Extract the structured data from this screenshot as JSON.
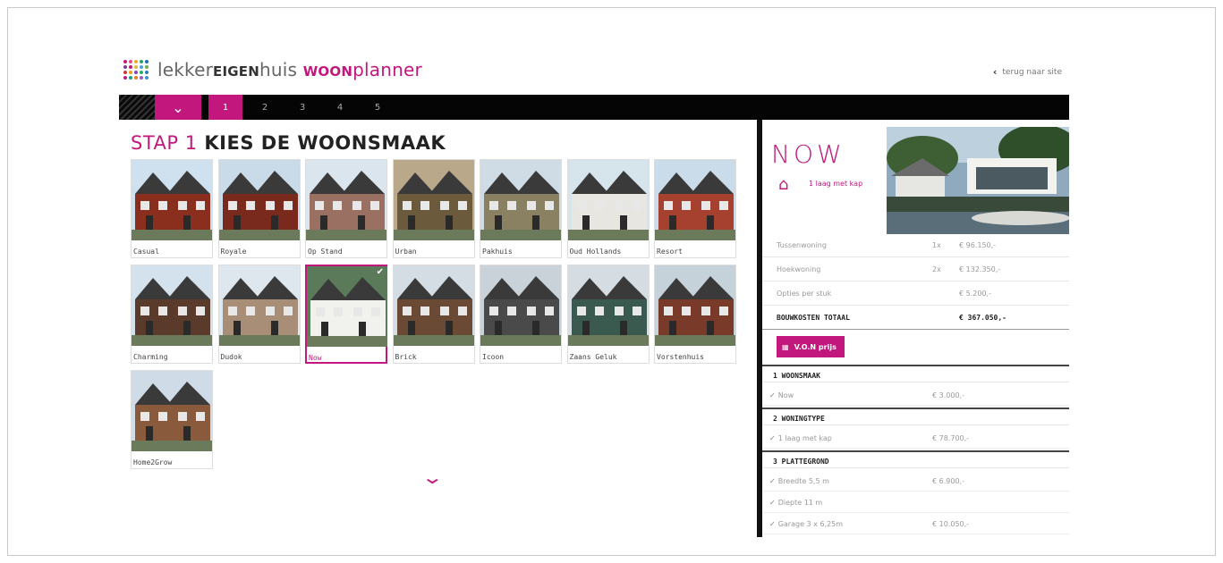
{
  "header": {
    "logo_part1": "lekker",
    "logo_part2": "EIGEN",
    "logo_part3": "huis ",
    "logo_part4": "WOON",
    "logo_part5": "planner",
    "back_link": "terug naar site"
  },
  "nav": {
    "steps": [
      "1",
      "2",
      "3",
      "4",
      "5"
    ],
    "active_step": "1"
  },
  "page": {
    "title_pink": "STAP 1",
    "title_rest": " KIES DE WOONSMAAK"
  },
  "tiles": [
    {
      "label": "Casual",
      "sky": "#cfe0ee",
      "house": "#8a2e1e"
    },
    {
      "label": "Royale",
      "sky": "#c9dbe8",
      "house": "#7a2a1c"
    },
    {
      "label": "Op Stand",
      "sky": "#dbe5ee",
      "house": "#9a7062"
    },
    {
      "label": "Urban",
      "sky": "#b9a88a",
      "house": "#6b5a3c"
    },
    {
      "label": "Pakhuis",
      "sky": "#cfdce6",
      "house": "#8a8062"
    },
    {
      "label": "Oud Hollands",
      "sky": "#d6e4ec",
      "house": "#e8e6e0"
    },
    {
      "label": "Resort",
      "sky": "#cadcea",
      "house": "#a5412e"
    },
    {
      "label": "Charming",
      "sky": "#d3e2ed",
      "house": "#5a3a2a"
    },
    {
      "label": "Dudok",
      "sky": "#dfe7ee",
      "house": "#a88e76"
    },
    {
      "label": "Now",
      "sky": "#5a7a5a",
      "house": "#f1f1ee",
      "selected": true
    },
    {
      "label": "Brick",
      "sky": "#d4dde4",
      "house": "#6a4a34"
    },
    {
      "label": "Icoon",
      "sky": "#c8d2d8",
      "house": "#4a4a4a"
    },
    {
      "label": "Zaans Geluk",
      "sky": "#d5dde3",
      "house": "#3a5a50"
    },
    {
      "label": "Vorstenhuis",
      "sky": "#c6d2da",
      "house": "#7a3a2a"
    },
    {
      "label": "Home2Grow",
      "sky": "#cfdbe6",
      "house": "#8a5a3c"
    }
  ],
  "panel": {
    "style_name": "NOW",
    "house_label": "1 laag met kap",
    "rows": [
      {
        "label": "Tussenwoning",
        "qty": "1x",
        "price": "€ 96.150,-"
      },
      {
        "label": "Hoekwoning",
        "qty": "2x",
        "price": "€ 132.350,-"
      },
      {
        "label": "Opties per stuk",
        "qty": "",
        "price": "€ 5.200,-"
      }
    ],
    "total_label": "BOUWKOSTEN TOTAAL",
    "total_value": "€ 367.050,-",
    "von_label": "V.O.N prijs",
    "sections": [
      {
        "title": "1 WOONSMAAK",
        "items": [
          {
            "label": "Now",
            "price": "€ 3.000,-"
          }
        ]
      },
      {
        "title": "2 WONINGTYPE",
        "items": [
          {
            "label": "1 laag met kap",
            "price": "€ 78.700,-"
          }
        ]
      },
      {
        "title": "3 PLATTEGROND",
        "items": [
          {
            "label": "Breedte 5,5 m",
            "price": "€ 6.900,-"
          },
          {
            "label": "Diepte 11 m",
            "price": ""
          },
          {
            "label": "Garage 3 x 6,25m",
            "price": "€ 10.050,-"
          }
        ]
      }
    ]
  },
  "colors": {
    "accent": "#c2187e",
    "navbar": "#050505"
  }
}
